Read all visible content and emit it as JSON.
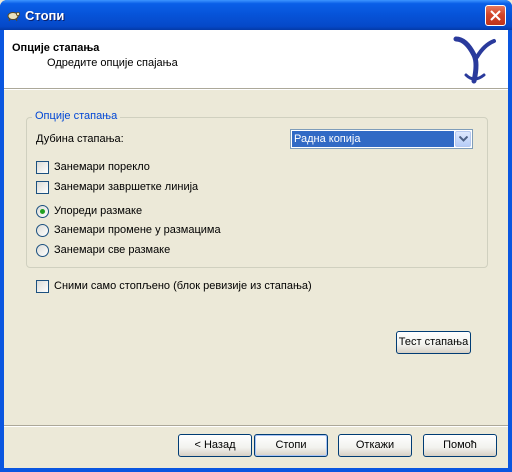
{
  "window": {
    "title": "Стопи"
  },
  "header": {
    "title": "Опције стапања",
    "subtitle": "Одредите опције спајања"
  },
  "options": {
    "group_title": "Опције стапања",
    "depth_label": "Дубина стапања:",
    "depth_selected": "Радна копија",
    "ignore_ancestry": {
      "label": "Занемари порекло",
      "checked": false
    },
    "ignore_eol": {
      "label": "Занемари завршетке линија",
      "checked": false
    },
    "whitespace": [
      {
        "label": "Упореди размаке",
        "selected": true
      },
      {
        "label": "Занемари промене у размацима",
        "selected": false
      },
      {
        "label": "Занемари све размаке",
        "selected": false
      }
    ]
  },
  "record_only": {
    "label": "Сними само стопљено (блок ревизије из стапања)",
    "checked": false
  },
  "test_merge_label": "Тест стапања",
  "footer": {
    "back_label": "< Назад",
    "merge_label": "Стопи",
    "cancel_label": "Откажи",
    "help_label": "Помоћ"
  },
  "colors": {
    "titlebar": "#0653d8",
    "group_title": "#0046d5",
    "selection": "#316ac5",
    "radio_dot": "#21a121",
    "logo": "#2a3a9c"
  },
  "icons": {
    "title": "tortoise-icon",
    "close": "close-icon",
    "logo": "merge-logo-icon",
    "dropdown": "chevron-down-icon"
  }
}
